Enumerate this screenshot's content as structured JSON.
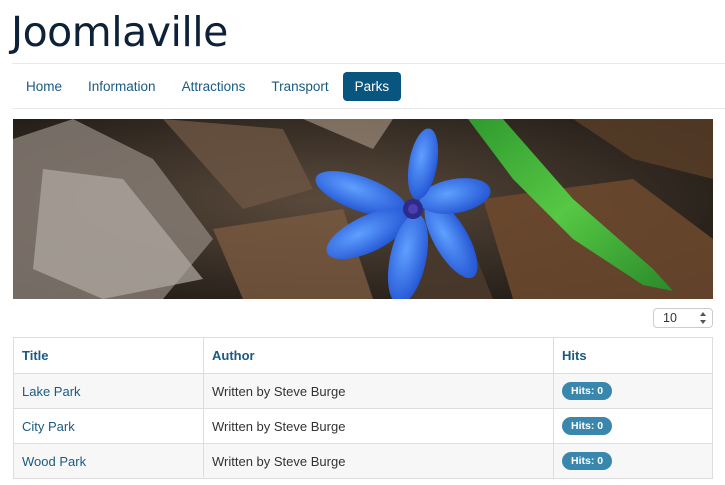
{
  "site": {
    "title": "Joomlaville"
  },
  "nav": {
    "items": [
      {
        "label": "Home"
      },
      {
        "label": "Information"
      },
      {
        "label": "Attractions"
      },
      {
        "label": "Transport"
      },
      {
        "label": "Parks",
        "active": true
      }
    ],
    "active_color": "#085580"
  },
  "banner": {
    "subject": "blue flower among dry leaves"
  },
  "list_limit": {
    "value": "10"
  },
  "table": {
    "headers": {
      "title": "Title",
      "author": "Author",
      "hits": "Hits"
    },
    "rows": [
      {
        "title": "Lake Park",
        "author": "Written by Steve Burge",
        "hits": "Hits: 0"
      },
      {
        "title": "City Park",
        "author": "Written by Steve Burge",
        "hits": "Hits: 0"
      },
      {
        "title": "Wood Park",
        "author": "Written by Steve Burge",
        "hits": "Hits: 0"
      }
    ]
  },
  "colors": {
    "link": "#1a5a82",
    "badge": "#3a87ad",
    "title": "#0d2138"
  }
}
